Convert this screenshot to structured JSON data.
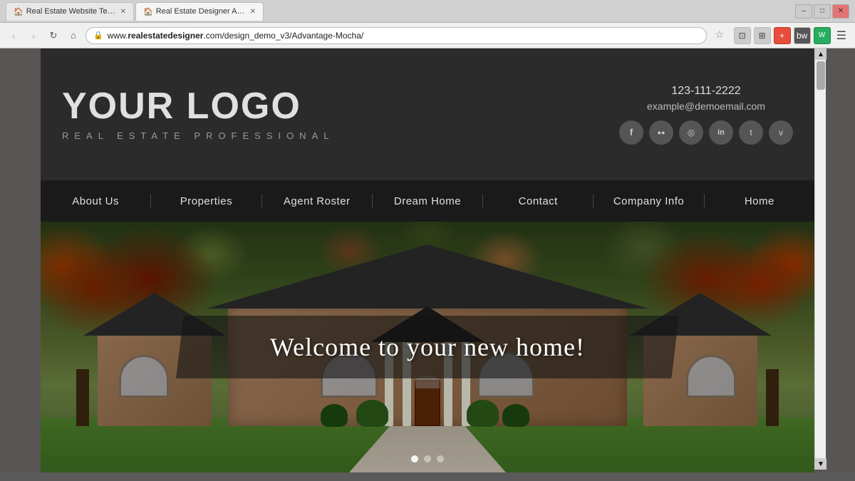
{
  "browser": {
    "tabs": [
      {
        "label": "Real Estate Website Temp...",
        "active": false,
        "favicon": "🏠"
      },
      {
        "label": "Real Estate Designer Adva...",
        "active": true,
        "favicon": "🏠"
      }
    ],
    "address_bar": {
      "protocol": "www.",
      "domain": "realestatedesigner",
      "path": ".com/design_demo_v3/Advantage-Mocha/"
    },
    "window_controls": {
      "minimize": "–",
      "maximize": "□",
      "close": "✕"
    },
    "nav_buttons": {
      "back": "‹",
      "forward": "›",
      "refresh": "↻",
      "home": "⌂"
    }
  },
  "site": {
    "header": {
      "logo_text": "YOUR LOGO",
      "tagline": "REAL ESTATE PROFESSIONAL",
      "phone": "123-111-2222",
      "email": "example@demoemail.com",
      "social_icons": [
        "f",
        "●●",
        "◎",
        "in",
        "t",
        "v"
      ]
    },
    "nav": {
      "items": [
        {
          "label": "About Us"
        },
        {
          "label": "Properties"
        },
        {
          "label": "Agent Roster"
        },
        {
          "label": "Dream Home"
        },
        {
          "label": "Contact"
        },
        {
          "label": "Company Info"
        },
        {
          "label": "Home"
        }
      ]
    },
    "hero": {
      "welcome_text": "Welcome to your new home!",
      "slider_dots": [
        true,
        false,
        false
      ]
    }
  },
  "colors": {
    "header_bg": "#2b2b2b",
    "nav_bg": "#1a1a1a",
    "logo_color": "#e0e0e0",
    "nav_text": "#e0e0e0",
    "accent": "#555555"
  }
}
